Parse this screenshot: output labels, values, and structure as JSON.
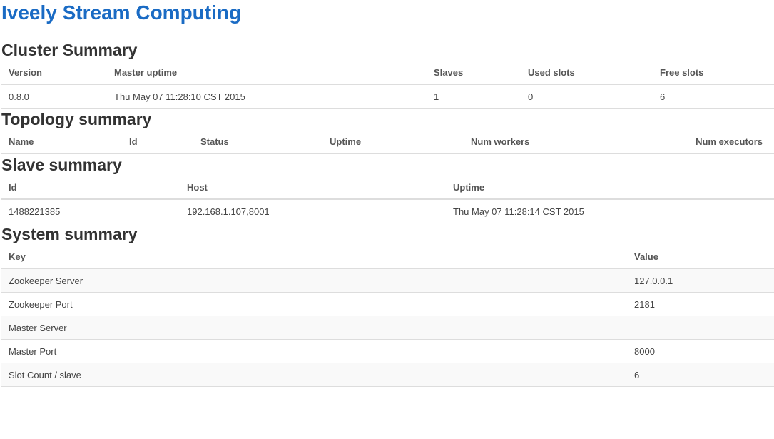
{
  "app_title": "Iveely Stream Computing",
  "cluster": {
    "title": "Cluster Summary",
    "headers": [
      "Version",
      "Master uptime",
      "Slaves",
      "Used slots",
      "Free slots"
    ],
    "row": [
      "0.8.0",
      "Thu May 07 11:28:10 CST 2015",
      "1",
      "0",
      "6"
    ]
  },
  "topology": {
    "title": "Topology summary",
    "headers": [
      "Name",
      "Id",
      "Status",
      "Uptime",
      "Num workers",
      "Num executors"
    ]
  },
  "slave": {
    "title": "Slave summary",
    "headers": [
      "Id",
      "Host",
      "Uptime"
    ],
    "row": [
      "1488221385",
      "192.168.1.107,8001",
      "Thu May 07 11:28:14 CST 2015"
    ]
  },
  "system": {
    "title": "System summary",
    "headers": [
      "Key",
      "Value"
    ],
    "rows": [
      [
        "Zookeeper Server",
        "127.0.0.1"
      ],
      [
        "Zookeeper Port",
        "2181"
      ],
      [
        "Master Server",
        ""
      ],
      [
        "Master Port",
        "8000"
      ],
      [
        "Slot Count / slave",
        "6"
      ]
    ]
  }
}
